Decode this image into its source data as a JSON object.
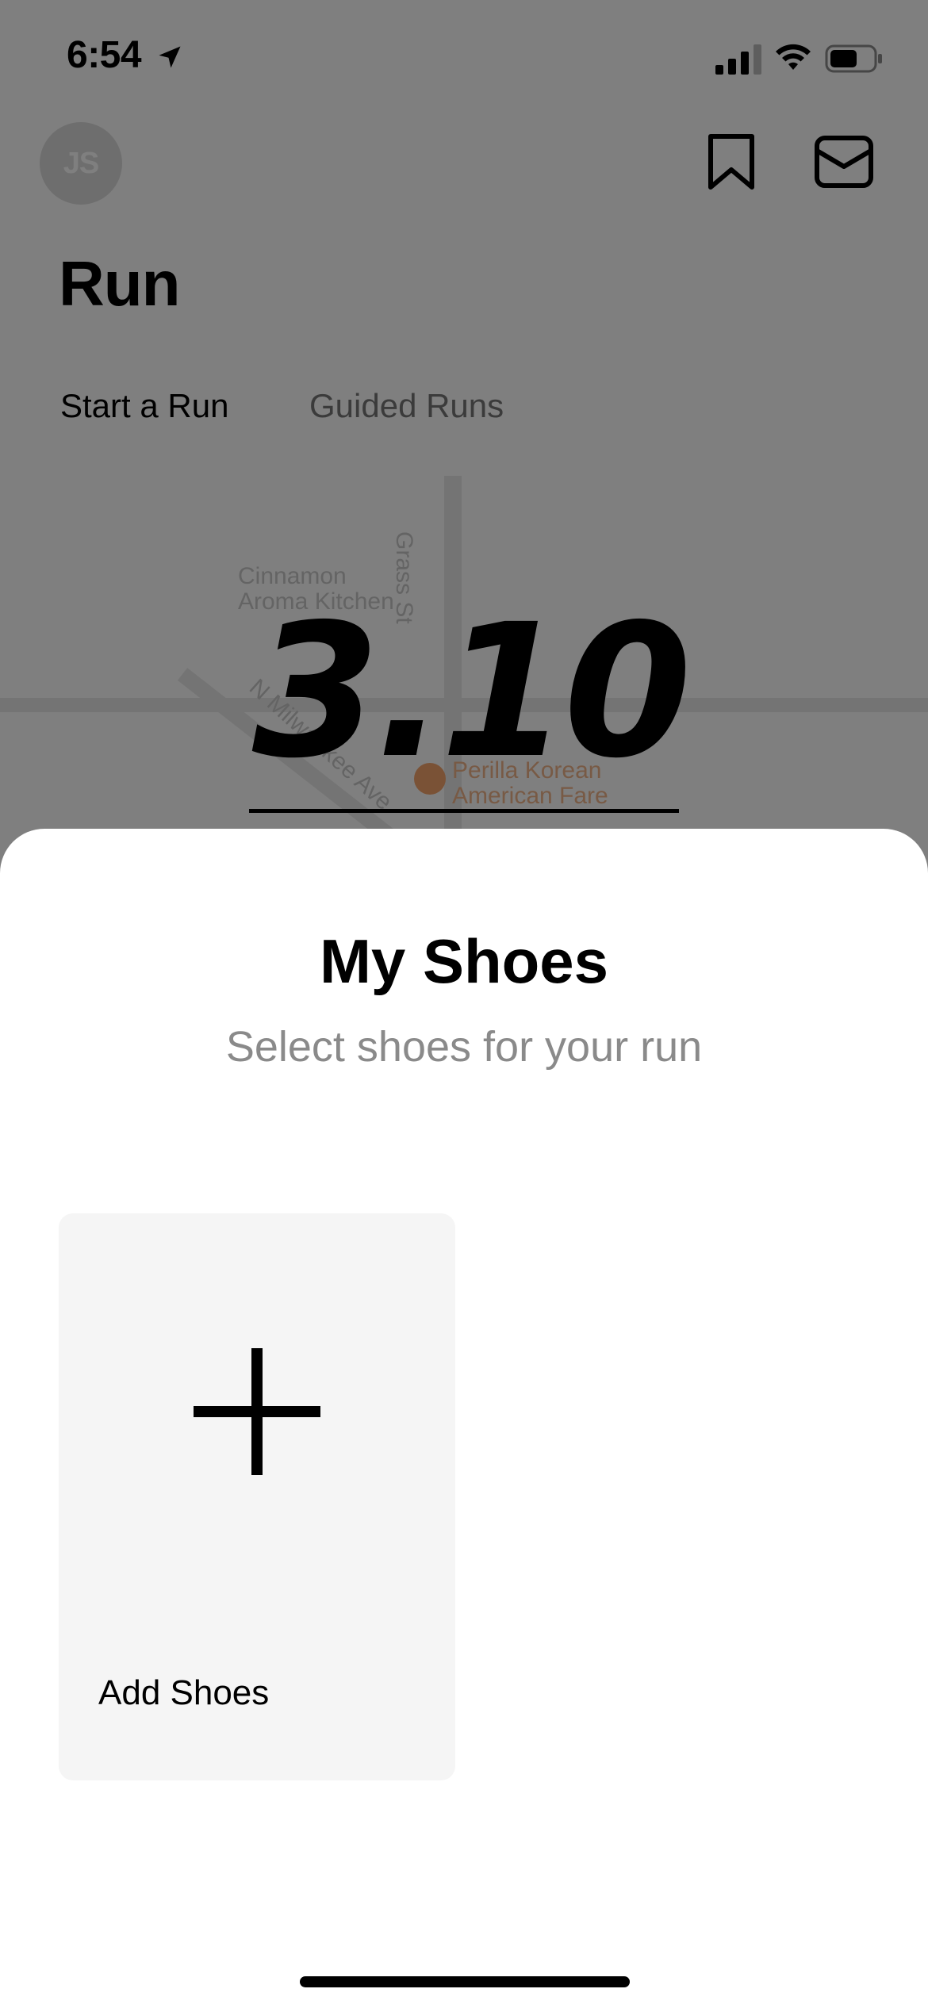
{
  "status_bar": {
    "time": "6:54",
    "icons": [
      "location-arrow-icon",
      "cellular-signal-icon",
      "wifi-icon",
      "battery-icon"
    ]
  },
  "header": {
    "avatar_initials": "JS",
    "right_icons": [
      "bookmark-icon",
      "inbox-icon"
    ]
  },
  "page": {
    "title": "Run",
    "tabs": [
      {
        "label": "Start a Run",
        "active": true
      },
      {
        "label": "Guided Runs",
        "active": false
      }
    ]
  },
  "map": {
    "labels": [
      "Cinnamon",
      "Aroma Kitchen",
      "Grass St",
      "N Milwaukee Ave"
    ],
    "poi": {
      "name_line1": "Perilla Korean",
      "name_line2": "American Fare",
      "icon": "restaurant-pin-icon"
    }
  },
  "run_goal": {
    "distance": "3.10"
  },
  "sheet": {
    "title": "My Shoes",
    "subtitle": "Select shoes for your run",
    "add_card": {
      "label": "Add Shoes",
      "icon": "plus-icon"
    }
  },
  "colors": {
    "overlay": "#000000",
    "sheet_background": "#ffffff",
    "card_background": "#f5f5f5",
    "subtitle_text": "#8a8a8a",
    "inactive_tab_text": "#777777",
    "poi_accent": "#f5a46d"
  }
}
